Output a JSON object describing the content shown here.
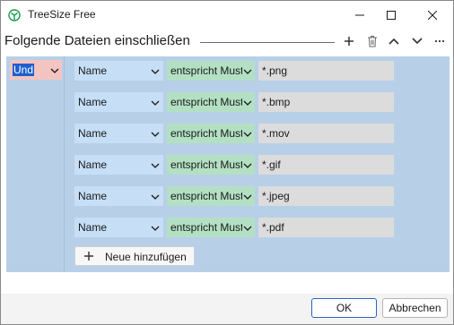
{
  "window": {
    "title": "TreeSize Free"
  },
  "header": {
    "title": "Folgende Dateien einschließen"
  },
  "group": {
    "operator": "Und"
  },
  "rows": [
    {
      "field": "Name",
      "operator": "entspricht Muster",
      "value": "*.png"
    },
    {
      "field": "Name",
      "operator": "entspricht Muster",
      "value": "*.bmp"
    },
    {
      "field": "Name",
      "operator": "entspricht Muster",
      "value": "*.mov"
    },
    {
      "field": "Name",
      "operator": "entspricht Muster",
      "value": "*.gif"
    },
    {
      "field": "Name",
      "operator": "entspricht Muster",
      "value": "*.jpeg"
    },
    {
      "field": "Name",
      "operator": "entspricht Muster",
      "value": "*.pdf"
    }
  ],
  "add_button": {
    "label": "Neue hinzufügen",
    "icon": "plus-icon"
  },
  "footer": {
    "ok_label": "OK",
    "cancel_label": "Abbrechen"
  },
  "icons": {
    "app": "treesize-logo-icon",
    "toolbar": [
      "plus-icon",
      "trash-icon",
      "chevron-up-icon",
      "chevron-down-icon",
      "more-icon"
    ],
    "window": [
      "minimize-icon",
      "maximize-icon",
      "close-icon"
    ]
  },
  "colors": {
    "group_operator": "#f4c4c0",
    "field_select": "#c6def6",
    "operator_select": "#b3e0c3",
    "value_input": "#dcdcdc",
    "panel": "#b8cfe8",
    "accent": "#2a63c6",
    "selection": "#1e5fcf"
  }
}
